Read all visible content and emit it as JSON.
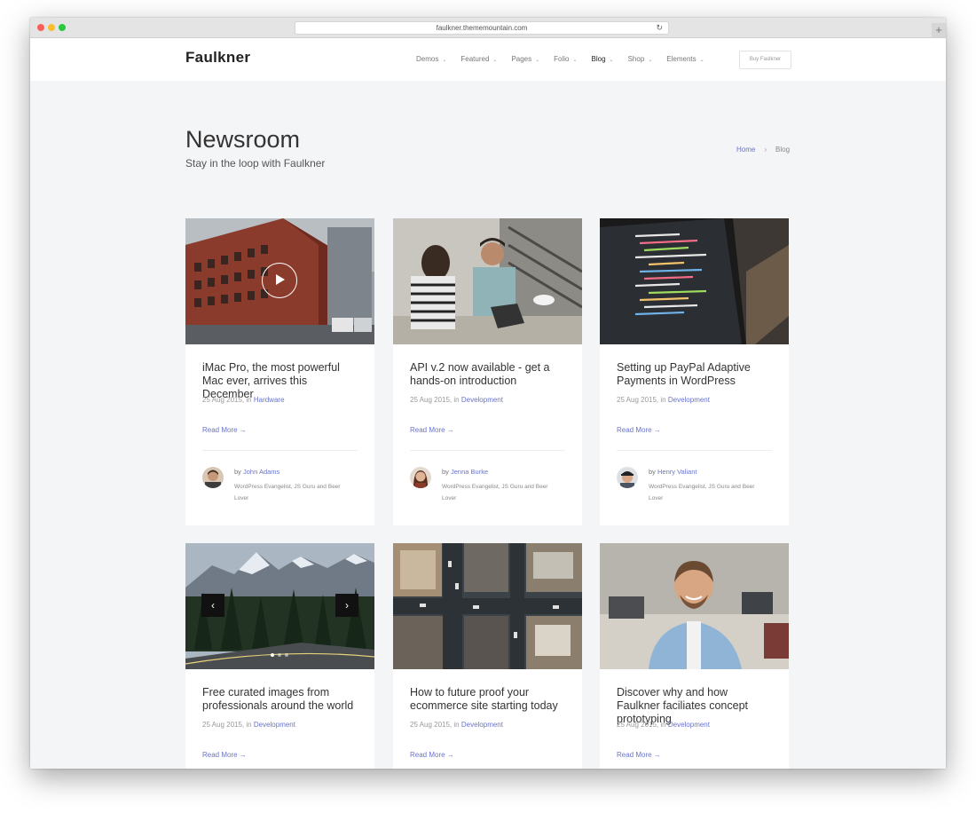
{
  "browser": {
    "url": "faulkner.thememountain.com"
  },
  "nav": {
    "logo": "Faulkner",
    "items": [
      {
        "label": "Demos",
        "active": false
      },
      {
        "label": "Featured",
        "active": false
      },
      {
        "label": "Pages",
        "active": false
      },
      {
        "label": "Folio",
        "active": false
      },
      {
        "label": "Blog",
        "active": true
      },
      {
        "label": "Shop",
        "active": false
      },
      {
        "label": "Elements",
        "active": false
      }
    ],
    "buy_label": "Buy Faulkner"
  },
  "hero": {
    "title": "Newsroom",
    "subtitle": "Stay in the loop with Faulkner"
  },
  "breadcrumb": {
    "home": "Home",
    "current": "Blog",
    "separator": "›"
  },
  "accent_color": "#6a74c9",
  "cards": [
    {
      "title": "iMac Pro, the most powerful Mac ever, arrives this December",
      "date": "25 Aug 2015, in",
      "category": "Hardware",
      "read_more": "Read More →",
      "author_by": "by",
      "author_name": "John Adams",
      "author_bio": "WordPress Evangelist, JS Guru and Beer Lover"
    },
    {
      "title": "API v.2 now available - get a hands-on introduction",
      "date": "25 Aug 2015, in",
      "category": "Development",
      "read_more": "Read More →",
      "author_by": "by",
      "author_name": "Jenna Burke",
      "author_bio": "WordPress Evangelist, JS Guru and Beer Lover"
    },
    {
      "title": "Setting up PayPal Adaptive Payments in WordPress",
      "date": "25 Aug 2015, in",
      "category": "Development",
      "read_more": "Read More →",
      "author_by": "by",
      "author_name": "Henry Valiant",
      "author_bio": "WordPress Evangelist, JS Guru and Beer Lover"
    },
    {
      "title": "Free curated images from professionals around the world",
      "date": "25 Aug 2015, in",
      "category": "Development",
      "read_more": "Read More →"
    },
    {
      "title": "How to future proof your ecommerce site starting today",
      "date": "25 Aug 2015, in",
      "category": "Development",
      "read_more": "Read More →"
    },
    {
      "title": "Discover why and how Faulkner faciliates concept prototyping",
      "date": "25 Aug 2015, in",
      "category": "Development",
      "read_more": "Read More →"
    }
  ],
  "slider": {
    "prev_icon": "‹",
    "next_icon": "›"
  }
}
